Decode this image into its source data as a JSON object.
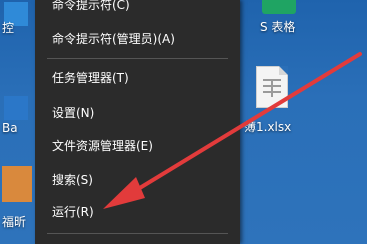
{
  "desktop": {
    "left_icons": [
      {
        "label": "控"
      },
      {
        "label": "Ba"
      },
      {
        "label": "福昕"
      }
    ],
    "excel_shortcut": {
      "label": "S 表格"
    },
    "xlsx_file": {
      "label": "簿1.xlsx"
    }
  },
  "context_menu": {
    "items": [
      {
        "label": "命令提示符(C)"
      },
      {
        "label": "命令提示符(管理员)(A)"
      },
      {
        "label": "任务管理器(T)"
      },
      {
        "label": "设置(N)"
      },
      {
        "label": "文件资源管理器(E)"
      },
      {
        "label": "搜索(S)"
      },
      {
        "label": "运行(R)"
      }
    ]
  },
  "annotation": {
    "color": "#e23b3b"
  }
}
